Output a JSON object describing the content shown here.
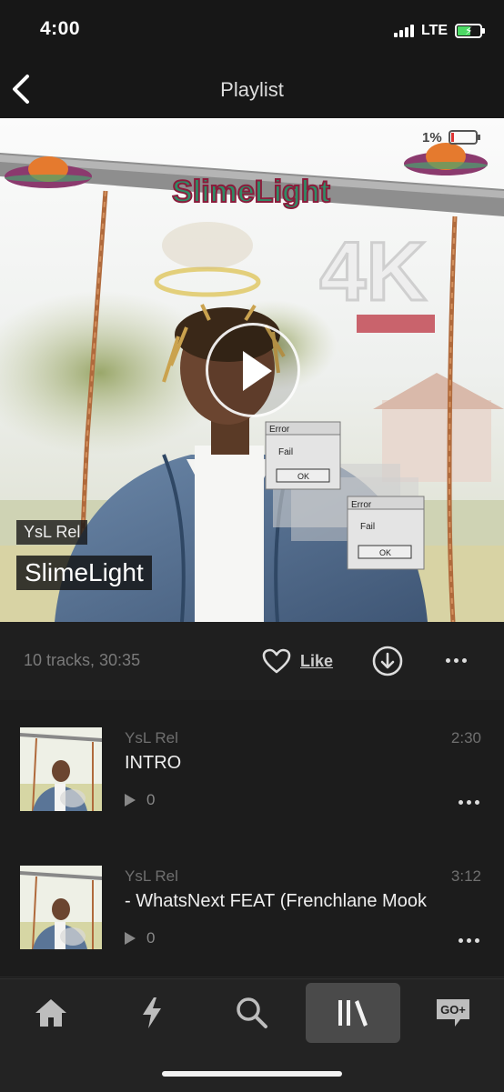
{
  "status_bar": {
    "time": "4:00",
    "network": "LTE"
  },
  "nav": {
    "title": "Playlist"
  },
  "hero": {
    "artist_label": "YsL Rel",
    "title_label": "SlimeLight",
    "artwork_logo": "SlimeLight",
    "artwork_battery_text": "1%",
    "artwork_4k": "4K",
    "error_title": "Error",
    "error_body": "Fail",
    "error_button": "OK"
  },
  "playlist_meta": {
    "summary": "10 tracks, 30:35",
    "like_label": "Like"
  },
  "tracks": [
    {
      "artist": "YsL Rel",
      "title": "INTRO",
      "duration": "2:30",
      "plays": "0"
    },
    {
      "artist": "YsL Rel",
      "title": "- WhatsNext FEAT (Frenchlane Mook",
      "duration": "3:12",
      "plays": "0"
    }
  ],
  "tab_bar": {
    "items": [
      {
        "icon": "home-icon",
        "active": false
      },
      {
        "icon": "lightning-icon",
        "active": false
      },
      {
        "icon": "search-icon",
        "active": false
      },
      {
        "icon": "library-icon",
        "active": true
      },
      {
        "icon": "go-plus-icon",
        "label": "GO+",
        "active": false
      }
    ]
  },
  "colors": {
    "background": "#1a1a1a",
    "active_tab": "#4a4a4a",
    "battery_green": "#4cd964",
    "muted_text": "#6f6f6f"
  }
}
